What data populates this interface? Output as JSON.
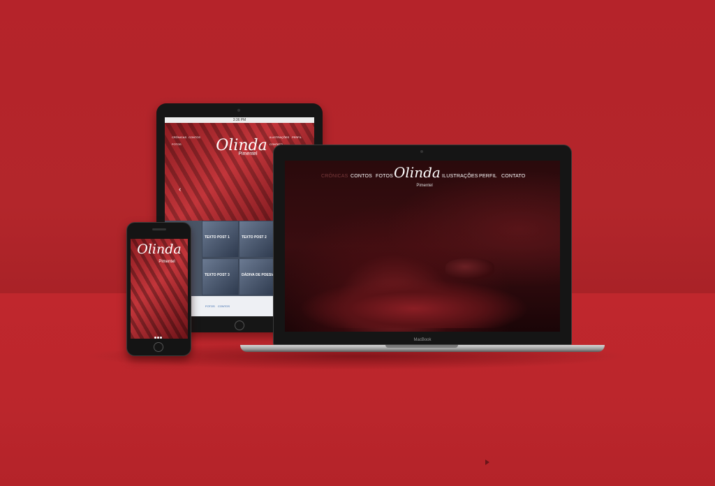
{
  "brand": {
    "logo_script": "Olinda",
    "logo_sub": "Pimentel"
  },
  "laptop": {
    "nav_left": [
      "CRÔNICAS",
      "CONTOS",
      "FOTOS"
    ],
    "nav_right": [
      "ILUSTRAÇÕES",
      "PERFIL",
      "CONTATO"
    ],
    "label": "MacBook"
  },
  "tablet": {
    "status_time": "3:36 PM",
    "nav": [
      "CRÔNICAS",
      "CONTOS",
      "FOTOS",
      "ILUSTRAÇÕES",
      "PERFIL",
      "CONTATO"
    ],
    "arrow": "‹",
    "posts": [
      "TEXTO POST 1",
      "TEXTO POST 2",
      "TEXTO POST 3",
      "DÁDIVA DE POESIA"
    ],
    "footer_links": [
      "FOTOS",
      "CONTOS"
    ]
  },
  "colors": {
    "background": "#b9242a",
    "device": "#151515"
  }
}
